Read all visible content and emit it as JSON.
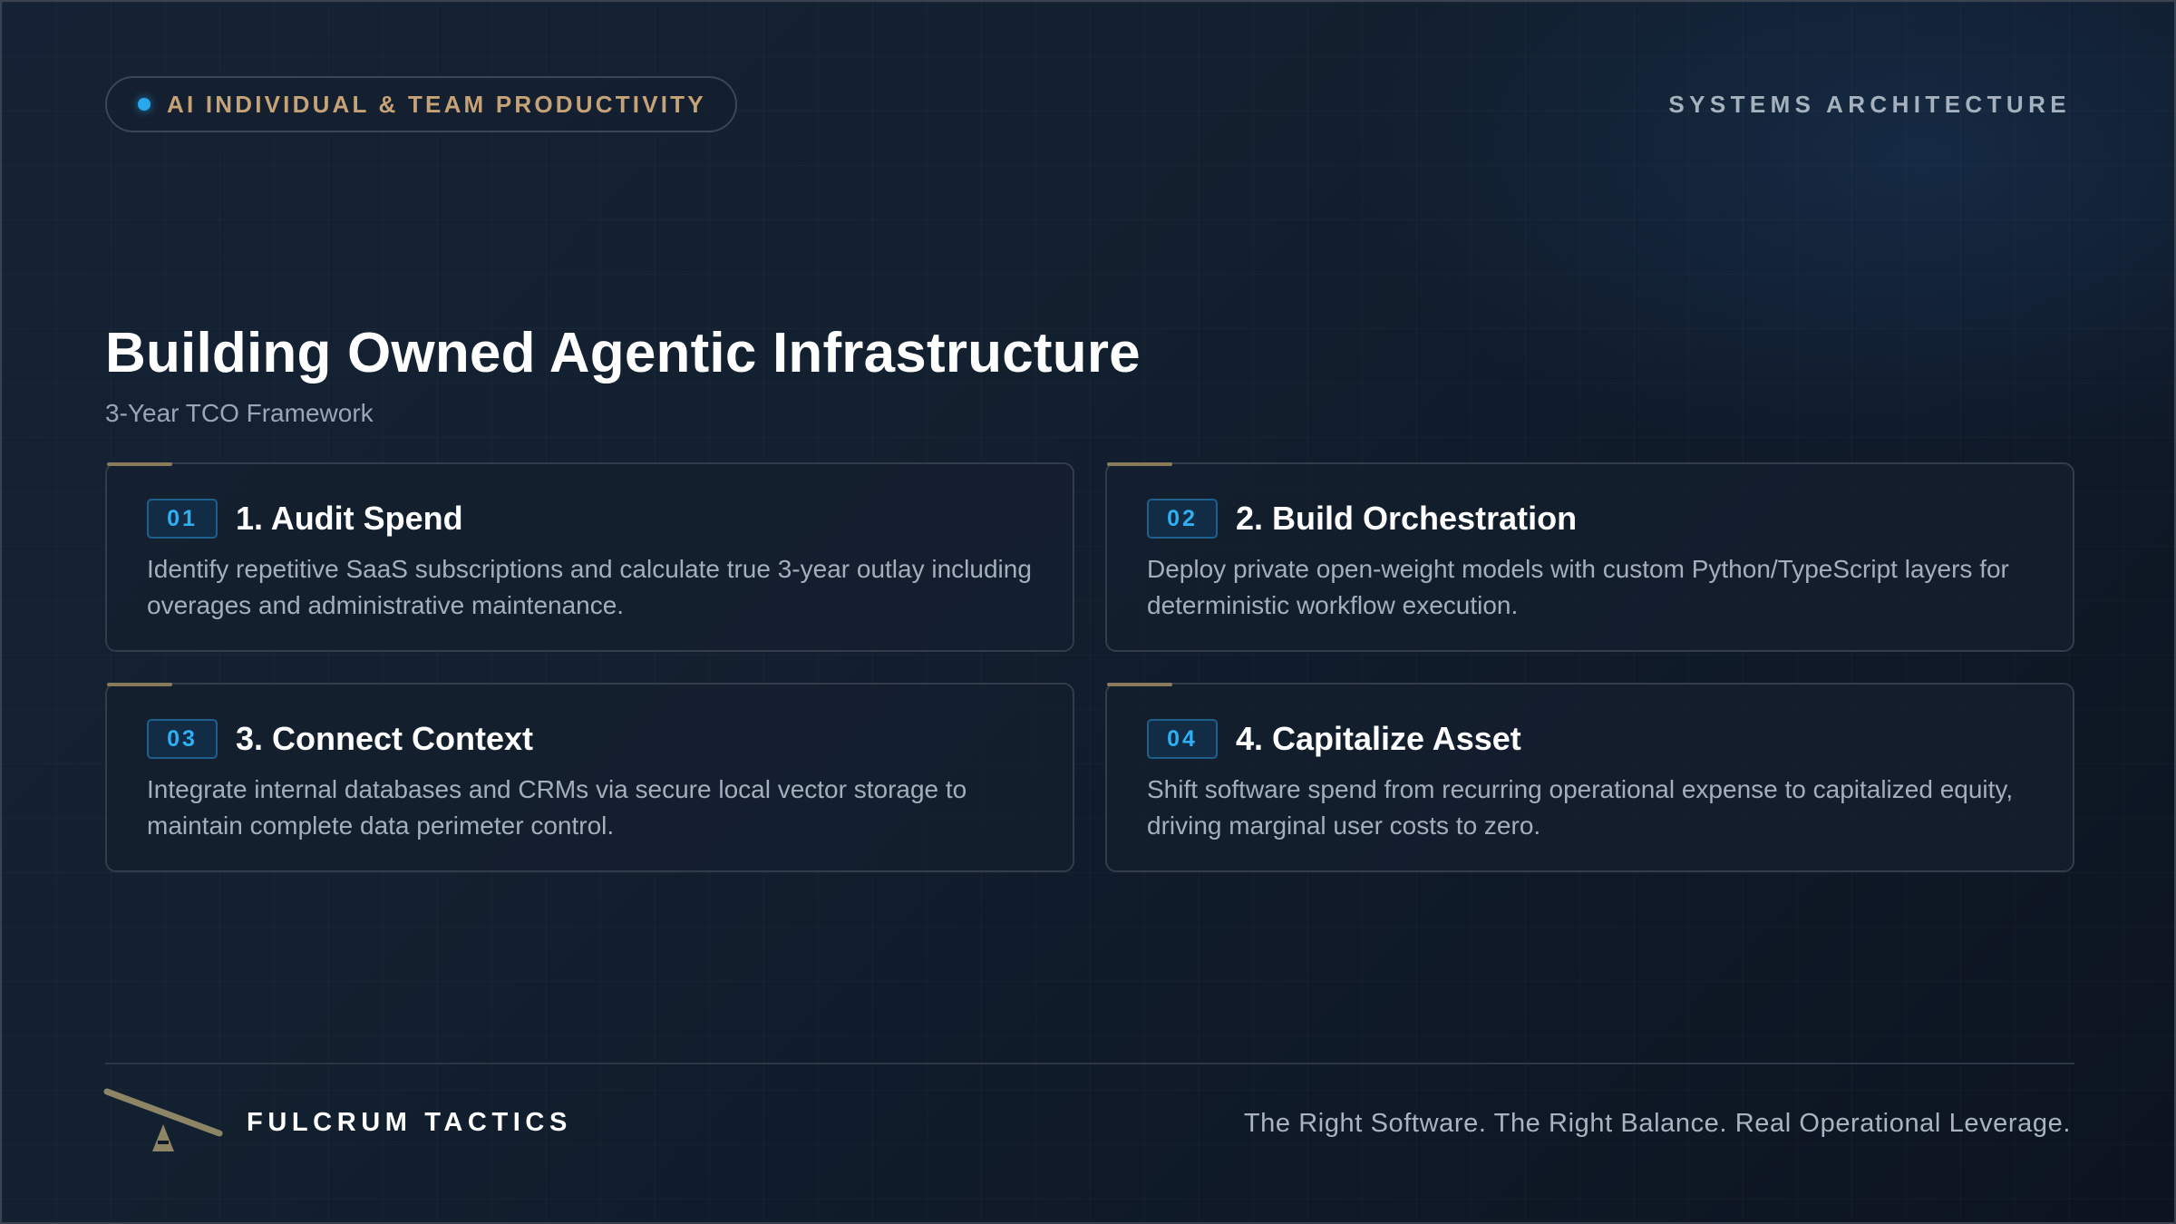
{
  "header": {
    "pill_label": "AI INDIVIDUAL & TEAM PRODUCTIVITY",
    "section_label": "SYSTEMS ARCHITECTURE"
  },
  "main": {
    "title": "Building Owned Agentic Infrastructure",
    "subtitle": "3-Year TCO Framework",
    "cards": [
      {
        "badge": "01",
        "title": "1. Audit Spend",
        "description": "Identify repetitive SaaS subscriptions and calculate true 3-year outlay including overages and administrative maintenance."
      },
      {
        "badge": "02",
        "title": "2. Build Orchestration",
        "description": "Deploy private open-weight models with custom Python/TypeScript layers for deterministic workflow execution."
      },
      {
        "badge": "03",
        "title": "3. Connect Context",
        "description": "Integrate internal databases and CRMs via secure local vector storage to maintain complete data perimeter control."
      },
      {
        "badge": "04",
        "title": "4. Capitalize Asset",
        "description": "Shift software spend from recurring operational expense to capitalized equity, driving marginal user costs to zero."
      }
    ]
  },
  "footer": {
    "brand": "FULCRUM TACTICS",
    "tagline": "The Right Software. The Right Balance. Real Operational Leverage.",
    "logo_icon": "seesaw-fulcrum-icon"
  },
  "colors": {
    "accent_blue": "#2aa8ee",
    "accent_gold": "#c6a376",
    "background": "#12202f"
  }
}
